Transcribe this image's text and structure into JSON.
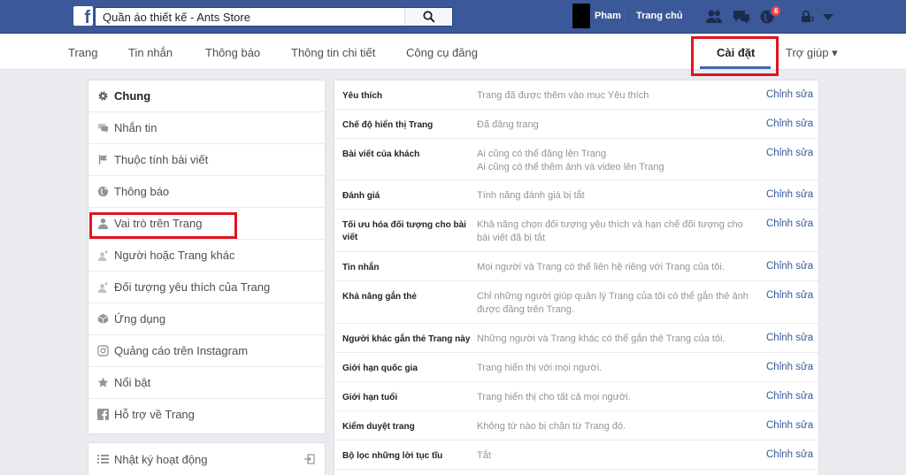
{
  "topbar": {
    "logo": "f",
    "search_value": "Quần áo thiết kế - Ants Store",
    "user_name": "Pham",
    "home_label": "Trang chủ",
    "notification_count": "6",
    "bg_color": "#3b5998"
  },
  "subnav": {
    "items": [
      "Trang",
      "Tin nhắn",
      "Thông báo",
      "Thông tin chi tiết",
      "Công cụ đăng"
    ],
    "settings_label": "Cài đặt",
    "help_label": "Trợ giúp ▾"
  },
  "sidebar": {
    "items": [
      {
        "label": "Chung",
        "icon": "gear-icon"
      },
      {
        "label": "Nhắn tin",
        "icon": "chat-icon"
      },
      {
        "label": "Thuộc tính bài viết",
        "icon": "flag-icon"
      },
      {
        "label": "Thông báo",
        "icon": "globe-icon"
      },
      {
        "label": "Vai trò trên Trang",
        "icon": "person-icon"
      },
      {
        "label": "Người hoặc Trang khác",
        "icon": "person-plus-icon"
      },
      {
        "label": "Đối tượng yêu thích của Trang",
        "icon": "person-star-icon"
      },
      {
        "label": "Ứng dụng",
        "icon": "cube-icon"
      },
      {
        "label": "Quảng cáo trên Instagram",
        "icon": "instagram-icon"
      },
      {
        "label": "Nổi bật",
        "icon": "star-icon"
      },
      {
        "label": "Hỗ trợ về Trang",
        "icon": "facebook-icon"
      }
    ],
    "activity_log": "Nhật ký hoạt động"
  },
  "settings": {
    "edit_label": "Chỉnh sửa",
    "rows": [
      {
        "name": "Yêu thích",
        "value": "Trang đã được thêm vào mục Yêu thích"
      },
      {
        "name": "Chế độ hiển thị Trang",
        "value": "Đã đăng trang"
      },
      {
        "name": "Bài viết của khách",
        "value": "Ai cũng có thể đăng lên Trang\nAi cũng có thể thêm ảnh và video lên Trang"
      },
      {
        "name": "Đánh giá",
        "value": "Tính năng đánh giá bị tắt"
      },
      {
        "name": "Tối ưu hóa đối tượng cho bài viết",
        "value": "Khả năng chọn đối tượng yêu thích và hạn chế đối tượng cho bài viết đã bị tắt"
      },
      {
        "name": "Tin nhắn",
        "value": "Mọi người và Trang có thể liên hệ riêng với Trang của tôi."
      },
      {
        "name": "Khả năng gắn thẻ",
        "value": "Chỉ những người giúp quản lý Trang của tôi có thể gắn thẻ ảnh được đăng trên Trang."
      },
      {
        "name": "Người khác gắn thẻ Trang này",
        "value": "Những người và Trang khác có thể gắn thẻ Trang của tôi."
      },
      {
        "name": "Giới hạn quốc gia",
        "value": "Trang hiển thị với mọi người."
      },
      {
        "name": "Giới hạn tuổi",
        "value": "Trang hiển thị cho tất cả mọi người."
      },
      {
        "name": "Kiểm duyệt trang",
        "value": "Không từ nào bị chặn từ Trang đó."
      },
      {
        "name": "Bộ lọc những lời tục tĩu",
        "value": "Tắt"
      }
    ]
  }
}
